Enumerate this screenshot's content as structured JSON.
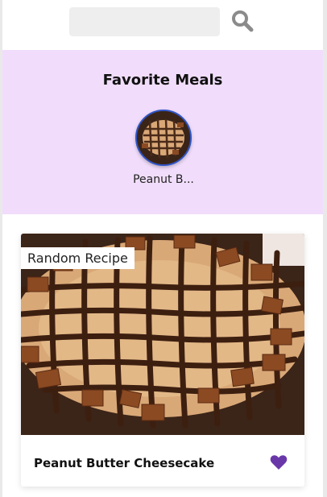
{
  "search": {
    "placeholder": "",
    "icon": "search-icon",
    "icon_color": "#8b8b8b"
  },
  "favorites": {
    "title": "Favorite Meals",
    "background": "#f1ddfb",
    "items": [
      {
        "name": "Peanut B..."
      }
    ]
  },
  "random_meal": {
    "tag": "Random Recipe",
    "title": "Peanut Butter Cheesecake",
    "favorite_icon": "heart-icon",
    "favorite_color": "#6a37a9"
  }
}
